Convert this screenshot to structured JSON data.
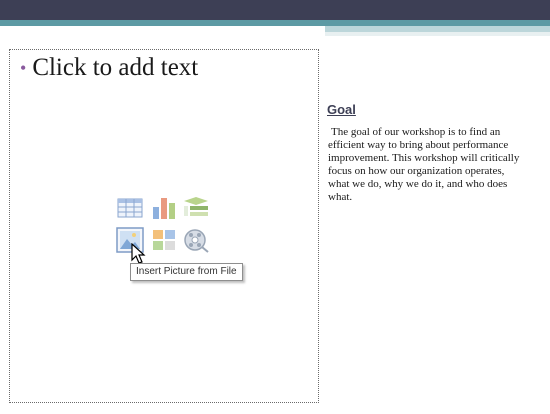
{
  "slide": {
    "placeholder_text": "Click to add text",
    "bullet": "•"
  },
  "insert_icons": [
    {
      "name": "insert-table-icon"
    },
    {
      "name": "insert-chart-icon"
    },
    {
      "name": "insert-smartart-icon"
    },
    {
      "name": "insert-picture-icon"
    },
    {
      "name": "insert-clipart-icon"
    },
    {
      "name": "insert-media-icon"
    }
  ],
  "tooltip": "Insert Picture from File",
  "textbox": {
    "title": "Goal",
    "body": "The goal of our workshop is to find an efficient way to bring about performance improvement. This workshop will critically focus on how our organization operates, what we do, why we do it, and who does what."
  },
  "colors": {
    "band_dark": "#3d3f55",
    "band_teal": "#5d9aa4",
    "bullet": "#8a5a9e"
  }
}
